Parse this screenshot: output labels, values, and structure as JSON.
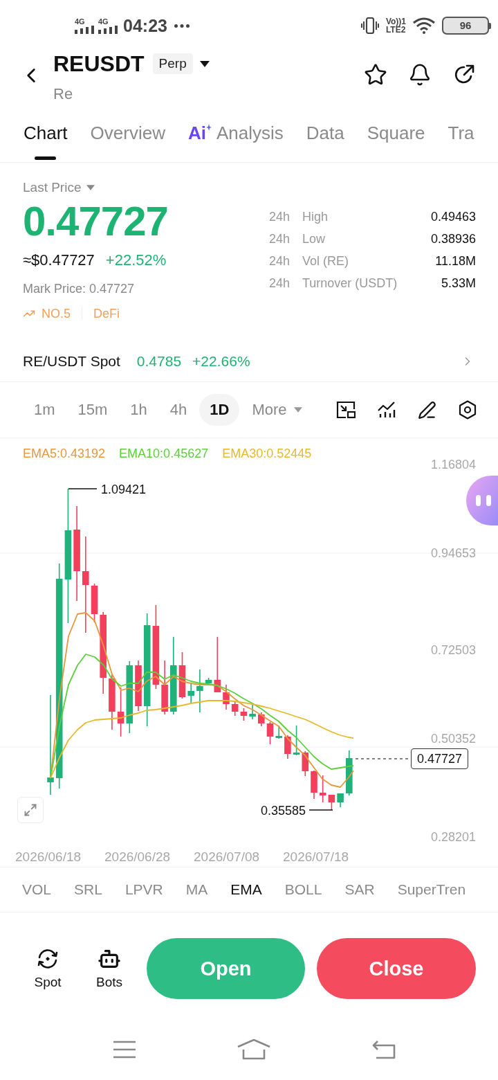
{
  "status_bar": {
    "networks": [
      "4G",
      "4G"
    ],
    "time": "04:23",
    "volte": "Vo))1",
    "lte": "LTE2",
    "battery": "96"
  },
  "header": {
    "title": "REUSDT",
    "contract": "Perp",
    "subtitle": "Re"
  },
  "tabs": [
    {
      "label": "Chart",
      "selected": true
    },
    {
      "label": "Overview",
      "selected": false
    },
    {
      "label": "Analysis",
      "badge": "Ai",
      "selected": false
    },
    {
      "label": "Data",
      "selected": false
    },
    {
      "label": "Square",
      "selected": false
    },
    {
      "label": "Tra",
      "selected": false
    }
  ],
  "price": {
    "label": "Last Price",
    "last": "0.47727",
    "usd": "≈$0.47727",
    "change": "+22.52%",
    "mark": "Mark Price: 0.47727",
    "tags": [
      {
        "kind": "rank",
        "label": "NO.5"
      },
      {
        "kind": "sector",
        "label": "DeFi"
      }
    ]
  },
  "stats": [
    {
      "period": "24h",
      "label": "High",
      "value": "0.49463"
    },
    {
      "period": "24h",
      "label": "Low",
      "value": "0.38936"
    },
    {
      "period": "24h",
      "label": "Vol (RE)",
      "value": "11.18M"
    },
    {
      "period": "24h",
      "label": "Turnover (USDT)",
      "value": "5.33M"
    }
  ],
  "spot": {
    "label": "RE/USDT Spot",
    "price": "0.4785",
    "change": "+22.66%"
  },
  "intervals": [
    {
      "label": "1m",
      "selected": false
    },
    {
      "label": "15m",
      "selected": false
    },
    {
      "label": "1h",
      "selected": false
    },
    {
      "label": "4h",
      "selected": false
    },
    {
      "label": "1D",
      "selected": true
    }
  ],
  "more": "More",
  "chart": {
    "legend": [
      {
        "label": "EMA5:0.43192",
        "color": "#e8973a"
      },
      {
        "label": "EMA10:0.45627",
        "color": "#5ccf3a"
      },
      {
        "label": "EMA30:0.52445",
        "color": "#e8b82a"
      }
    ],
    "y_axis": [
      "1.16804",
      "0.94653",
      "0.72503",
      "0.50352",
      "0.28201"
    ],
    "high": "1.09421",
    "low": "0.35585",
    "last_price": "0.47727",
    "x_axis": [
      "2026/06/18",
      "2026/06/28",
      "2026/07/08",
      "2026/07/18"
    ]
  },
  "indicators": [
    {
      "label": "VOL",
      "selected": false
    },
    {
      "label": "SRL",
      "selected": false
    },
    {
      "label": "LPVR",
      "selected": false
    },
    {
      "label": "MA",
      "selected": false
    },
    {
      "label": "EMA",
      "selected": true
    },
    {
      "label": "BOLL",
      "selected": false
    },
    {
      "label": "SAR",
      "selected": false
    },
    {
      "label": "SuperTren",
      "selected": false
    }
  ],
  "actions": {
    "shortcuts": [
      {
        "kind": "spot",
        "label": "Spot"
      },
      {
        "kind": "bots",
        "label": "Bots"
      }
    ],
    "open": "Open",
    "close": "Close"
  }
}
